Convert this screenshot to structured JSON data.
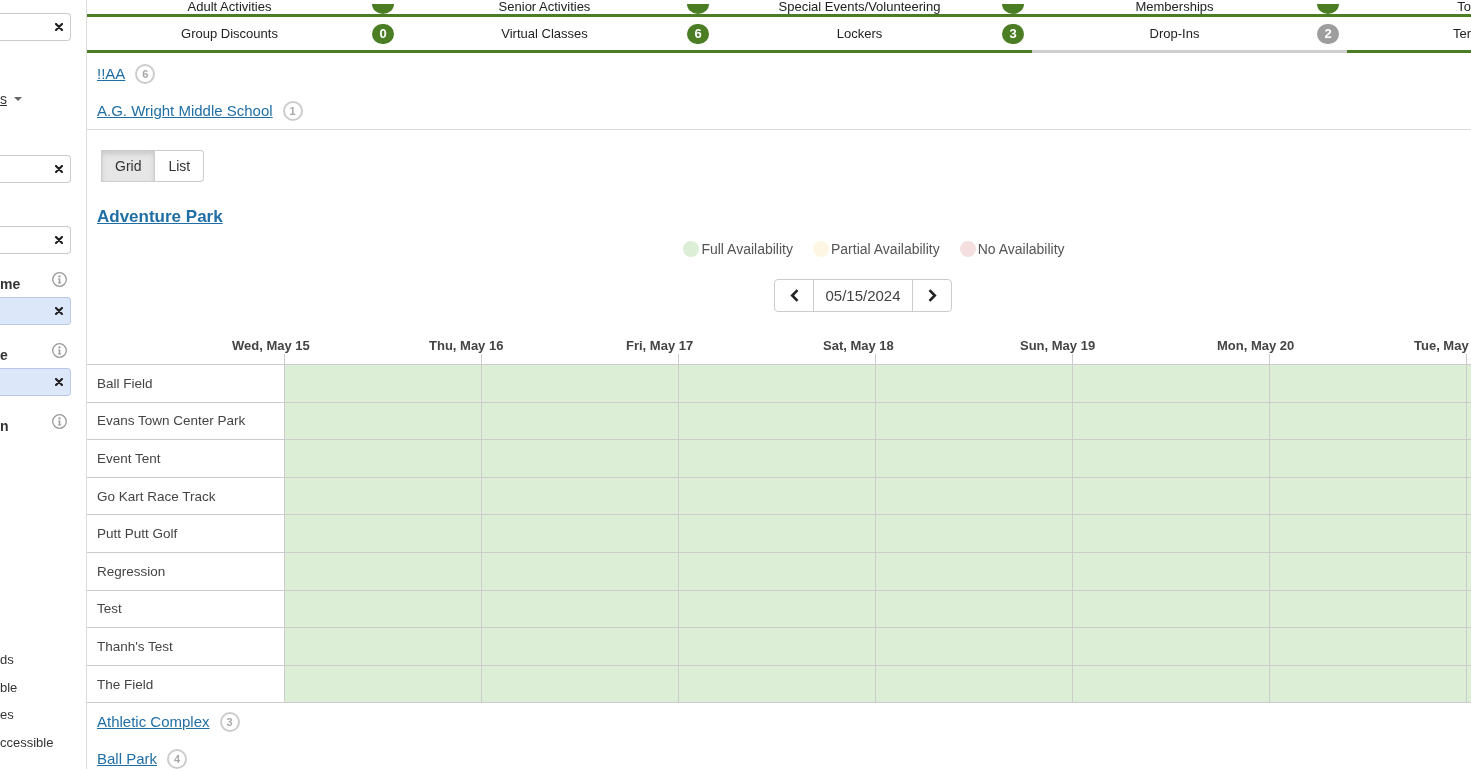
{
  "sidebar": {
    "filters": [
      {
        "kind": "field",
        "highlighted": false
      },
      {
        "kind": "link",
        "label": "s"
      },
      {
        "kind": "field",
        "highlighted": false
      },
      {
        "kind": "field",
        "highlighted": false
      },
      {
        "kind": "label",
        "label": "me"
      },
      {
        "kind": "field",
        "highlighted": true
      },
      {
        "kind": "label",
        "label": "e"
      },
      {
        "kind": "field",
        "highlighted": true
      },
      {
        "kind": "label",
        "label": "n"
      }
    ],
    "options": [
      "ds",
      "ble",
      "es",
      "ccessible"
    ]
  },
  "tab_rows": [
    {
      "tabs": [
        {
          "label": "Adult Activities",
          "badge": true,
          "selected": false
        },
        {
          "label": "Senior Activities",
          "badge": true,
          "selected": false
        },
        {
          "label": "Special Events/Volunteering",
          "badge": true,
          "selected": false
        },
        {
          "label": "Memberships",
          "badge": true,
          "selected": false
        },
        {
          "label": "To",
          "badge": false,
          "selected": false
        }
      ]
    },
    {
      "tabs": [
        {
          "label": "Group Discounts",
          "count": "0",
          "selected": false
        },
        {
          "label": "Virtual Classes",
          "count": "6",
          "selected": false
        },
        {
          "label": "Lockers",
          "count": "3",
          "selected": false
        },
        {
          "label": "Drop-Ins",
          "count": "2",
          "selected": true
        },
        {
          "label": "Ter",
          "selected": false
        }
      ]
    }
  ],
  "locations": [
    {
      "name": "!!AA",
      "count": "6",
      "expanded": false
    },
    {
      "name": "A.G. Wright Middle School",
      "count": "1",
      "expanded": false
    },
    {
      "name": "Adventure Park",
      "expanded": true,
      "view_toggle": [
        {
          "label": "Grid",
          "selected": true
        },
        {
          "label": "List",
          "selected": false
        }
      ],
      "legend": [
        {
          "kind": "full",
          "label": "Full Availability",
          "color": "#ddeed6"
        },
        {
          "kind": "partial",
          "label": "Partial Availability",
          "color": "#fcf6e2"
        },
        {
          "kind": "none",
          "label": "No Availability",
          "color": "#f3dfe0"
        }
      ],
      "date": "05/15/2024",
      "days": [
        "Wed, May 15",
        "Thu, May 16",
        "Fri, May 17",
        "Sat, May 18",
        "Sun, May 19",
        "Mon, May 20",
        "Tue, May"
      ],
      "rows": [
        {
          "name": "Ball Field",
          "cells": [
            {
              "kind": "full"
            },
            {
              "kind": "full"
            },
            {
              "kind": "full"
            },
            {
              "kind": "full"
            },
            {
              "kind": "full"
            },
            {
              "kind": "full"
            },
            {
              "kind": "full"
            }
          ]
        },
        {
          "name": "Evans Town Center Park",
          "cells": [
            {
              "kind": "full"
            },
            {
              "kind": "full"
            },
            {
              "kind": "full"
            },
            {
              "kind": "full"
            },
            {
              "kind": "full"
            },
            {
              "kind": "full"
            },
            {
              "kind": "full"
            }
          ]
        },
        {
          "name": "Event Tent",
          "cells": [
            {
              "kind": "full"
            },
            {
              "kind": "full"
            },
            {
              "kind": "full"
            },
            {
              "kind": "full"
            },
            {
              "kind": "full"
            },
            {
              "kind": "full"
            },
            {
              "kind": "full"
            }
          ]
        },
        {
          "name": "Go Kart Race Track",
          "cells": [
            {
              "kind": "full"
            },
            {
              "kind": "full"
            },
            {
              "kind": "full"
            },
            {
              "kind": "full"
            },
            {
              "kind": "full"
            },
            {
              "kind": "full"
            },
            {
              "kind": "full"
            }
          ]
        },
        {
          "name": "Putt Putt Golf",
          "cells": [
            {
              "kind": "full"
            },
            {
              "kind": "full"
            },
            {
              "kind": "full"
            },
            {
              "kind": "full"
            },
            {
              "kind": "full"
            },
            {
              "kind": "full"
            },
            {
              "kind": "full"
            }
          ]
        },
        {
          "name": "Regression",
          "cells": [
            {
              "kind": "full"
            },
            {
              "kind": "full"
            },
            {
              "kind": "full"
            },
            {
              "kind": "full"
            },
            {
              "kind": "full"
            },
            {
              "kind": "full"
            },
            {
              "kind": "full"
            }
          ]
        },
        {
          "name": "Test",
          "cells": [
            {
              "kind": "full"
            },
            {
              "kind": "full"
            },
            {
              "kind": "full"
            },
            {
              "kind": "full"
            },
            {
              "kind": "full"
            },
            {
              "kind": "full"
            },
            {
              "kind": "full"
            }
          ]
        },
        {
          "name": "Thanh's Test",
          "cells": [
            {
              "kind": "full"
            },
            {
              "kind": "full"
            },
            {
              "kind": "full"
            },
            {
              "kind": "full"
            },
            {
              "kind": "full"
            },
            {
              "kind": "full"
            },
            {
              "kind": "full"
            }
          ]
        },
        {
          "name": "The Field",
          "cells": [
            {
              "kind": "full"
            },
            {
              "kind": "full"
            },
            {
              "kind": "full"
            },
            {
              "kind": "full"
            },
            {
              "kind": "full"
            },
            {
              "kind": "full"
            },
            {
              "kind": "full"
            }
          ]
        }
      ]
    },
    {
      "name": "Athletic Complex",
      "count": "3",
      "expanded": false
    },
    {
      "name": "Ball Park",
      "count": "4",
      "expanded": false
    }
  ]
}
